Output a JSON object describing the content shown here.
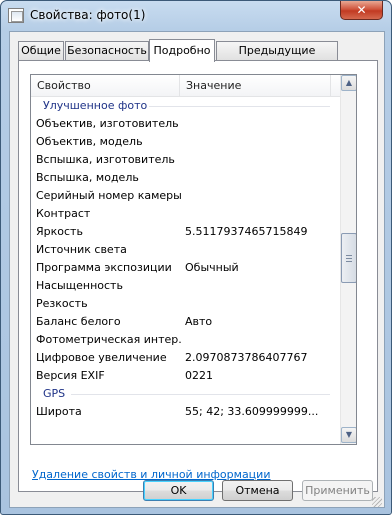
{
  "window": {
    "title": "Свойства: фото(1)",
    "close_label": "✕"
  },
  "tabs": [
    {
      "label": "Общие"
    },
    {
      "label": "Безопасность"
    },
    {
      "label": "Подробно"
    },
    {
      "label": "Предыдущие версии"
    }
  ],
  "active_tab": "Подробно",
  "list": {
    "columns": {
      "name": "Свойство",
      "value": "Значение"
    },
    "groups": [
      {
        "title": "Улучшенное фото",
        "rows": [
          {
            "name": "Объектив, изготовитель",
            "value": ""
          },
          {
            "name": "Объектив, модель",
            "value": ""
          },
          {
            "name": "Вспышка, изготовитель",
            "value": ""
          },
          {
            "name": "Вспышка, модель",
            "value": ""
          },
          {
            "name": "Серийный номер камеры",
            "value": ""
          },
          {
            "name": "Контраст",
            "value": ""
          },
          {
            "name": "Яркость",
            "value": "5.5117937465715849"
          },
          {
            "name": "Источник света",
            "value": ""
          },
          {
            "name": "Программа экспозиции",
            "value": "Обычный"
          },
          {
            "name": "Насыщенность",
            "value": ""
          },
          {
            "name": "Резкость",
            "value": ""
          },
          {
            "name": "Баланс белого",
            "value": "Авто"
          },
          {
            "name": "Фотометрическая интер...",
            "value": ""
          },
          {
            "name": "Цифровое увеличение",
            "value": "2.0970873786407767"
          },
          {
            "name": "Версия EXIF",
            "value": "0221"
          }
        ]
      },
      {
        "title": "GPS",
        "rows": [
          {
            "name": "Широта",
            "value": "55; 42; 33.609999999..."
          }
        ]
      }
    ]
  },
  "scrollbar": {
    "up_icon": "▲",
    "down_icon": "▼"
  },
  "remove_link": "Удаление свойств и личной информации",
  "buttons": {
    "ok": "OK",
    "cancel": "Отмена",
    "apply": "Применить"
  }
}
